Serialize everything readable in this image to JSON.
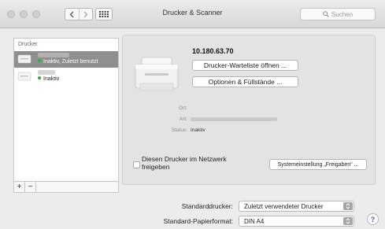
{
  "window": {
    "title": "Drucker & Scanner",
    "search_placeholder": "Suchen",
    "icons": {
      "back": "chevron-left-icon",
      "forward": "chevron-right-icon",
      "show_all": "grid-icon",
      "search": "search-icon"
    }
  },
  "printer_list": {
    "header": "Drucker",
    "printers": [
      {
        "name": "",
        "status": "Inaktiv, Zuletzt benutzt",
        "selected": true
      },
      {
        "name": "",
        "status": "Inaktiv",
        "selected": false
      }
    ],
    "add_label": "+",
    "remove_label": "−"
  },
  "detail": {
    "ip": "10.180.63.70",
    "queue_button": "Drucker-Warteliste öffnen ...",
    "options_button": "Optionen & Füllstände ...",
    "location_label": "Ort:",
    "kind_label": "Art:",
    "status_label": "Status:",
    "status_value": "Inaktiv",
    "share_checkbox_label": "Diesen Drucker im Netzwerk freigeben",
    "share_checked": false,
    "sharing_prefs_button": "Systemeinstellung „Freigaben“ ..."
  },
  "defaults": {
    "default_printer_label": "Standarddrucker:",
    "default_printer_value": "Zuletzt verwendeter Drucker",
    "paper_size_label": "Standard-Papierformat:",
    "paper_size_value": "DIN A4",
    "help_label": "?"
  },
  "colors": {
    "selection": "#8f8f8f",
    "status_dot": "#27b33a",
    "help": "#2f6fd6"
  }
}
